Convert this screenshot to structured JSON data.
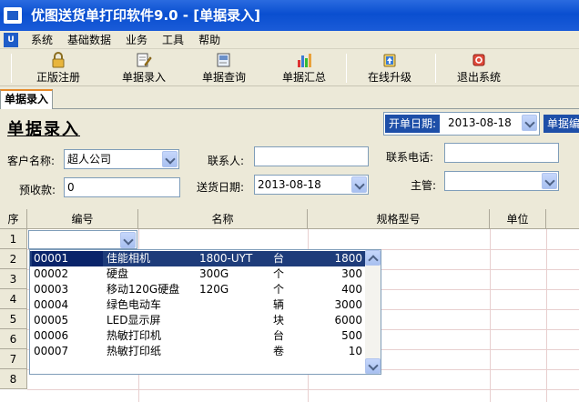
{
  "window": {
    "title": "优图送货单打印软件9.0 - [单据录入]"
  },
  "menu": {
    "logo": "U",
    "items": [
      "系统",
      "基础数据",
      "业务",
      "工具",
      "帮助"
    ]
  },
  "toolbar": {
    "buttons": [
      {
        "label": "正版注册",
        "icon": "lock-icon"
      },
      {
        "label": "单据录入",
        "icon": "document-edit-icon"
      },
      {
        "label": "单据查询",
        "icon": "search-document-icon"
      },
      {
        "label": "单据汇总",
        "icon": "bar-chart-icon"
      },
      {
        "label": "在线升级",
        "icon": "upgrade-icon"
      },
      {
        "label": "退出系统",
        "icon": "exit-icon"
      }
    ]
  },
  "tabs": [
    {
      "label": "单据录入",
      "active": true
    }
  ],
  "form": {
    "page_title": "单据录入",
    "open_date_label": "开单日期:",
    "open_date_value": "2013-08-18",
    "bill_no_label": "单据编号",
    "customer_label": "客户名称:",
    "customer_value": "超人公司",
    "contact_label": "联系人:",
    "contact_value": "",
    "phone_label": "联系电话:",
    "phone_value": "",
    "prepaid_label": "预收款:",
    "prepaid_value": "0",
    "delivery_date_label": "送货日期:",
    "delivery_date_value": "2013-08-18",
    "supervisor_label": "主管:",
    "supervisor_value": ""
  },
  "grid": {
    "headers": [
      "序",
      "编号",
      "名称",
      "规格型号",
      "单位"
    ],
    "row_numbers": [
      "1",
      "2",
      "3",
      "4",
      "5",
      "6",
      "7",
      "8"
    ]
  },
  "dropdown": {
    "rows": [
      {
        "code": "00001",
        "name": "佳能相机",
        "spec": "1800-UYT",
        "unit": "台",
        "price": "1800",
        "selected": true
      },
      {
        "code": "00002",
        "name": "硬盘",
        "spec": "300G",
        "unit": "个",
        "price": "300"
      },
      {
        "code": "00003",
        "name": "移动120G硬盘",
        "spec": "120G",
        "unit": "个",
        "price": "400"
      },
      {
        "code": "00004",
        "name": "绿色电动车",
        "spec": "",
        "unit": "辆",
        "price": "3000"
      },
      {
        "code": "00005",
        "name": "LED显示屏",
        "spec": "",
        "unit": "块",
        "price": "6000"
      },
      {
        "code": "00006",
        "name": "热敏打印机",
        "spec": "",
        "unit": "台",
        "price": "500"
      },
      {
        "code": "00007",
        "name": "热敏打印纸",
        "spec": "",
        "unit": "卷",
        "price": "10"
      }
    ]
  },
  "colors": {
    "title_bar": "#0A4FD0",
    "selection": "#0A246A",
    "date_label_bg": "#1E4FA8",
    "tab_accent": "#E68B2C"
  }
}
